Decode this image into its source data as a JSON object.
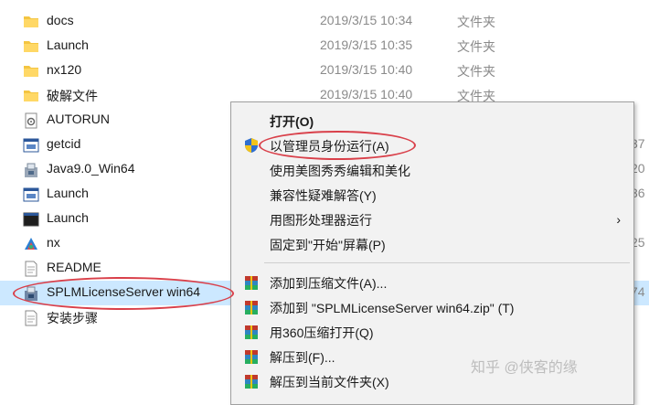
{
  "files": [
    {
      "name": "docs",
      "date": "2019/3/15 10:34",
      "type": "文件夹",
      "size": "",
      "icon": "folder-icon"
    },
    {
      "name": "Launch",
      "date": "2019/3/15 10:35",
      "type": "文件夹",
      "size": "",
      "icon": "folder-icon"
    },
    {
      "name": "nx120",
      "date": "2019/3/15 10:40",
      "type": "文件夹",
      "size": "",
      "icon": "folder-icon"
    },
    {
      "name": "破解文件",
      "date": "2019/3/15 10:40",
      "type": "文件夹",
      "size": "",
      "icon": "folder-icon"
    },
    {
      "name": "AUTORUN",
      "date": "",
      "type": "",
      "size": "",
      "icon": "settings-file-icon"
    },
    {
      "name": "getcid",
      "date": "",
      "type": "",
      "size": "37",
      "icon": "app-window-icon"
    },
    {
      "name": "Java9.0_Win64",
      "date": "",
      "type": "",
      "size": "20",
      "icon": "installer-icon"
    },
    {
      "name": "Launch",
      "date": "",
      "type": "",
      "size": "36",
      "icon": "app-window-icon"
    },
    {
      "name": "Launch",
      "date": "",
      "type": "",
      "size": "",
      "icon": "console-window-icon"
    },
    {
      "name": "nx",
      "date": "",
      "type": "",
      "size": "25",
      "icon": "nx-logo-icon"
    },
    {
      "name": "README",
      "date": "",
      "type": "",
      "size": "",
      "icon": "text-file-icon"
    },
    {
      "name": "SPLMLicenseServer win64",
      "date": "",
      "type": "",
      "size": "74",
      "icon": "installer-icon"
    },
    {
      "name": "安装步骤",
      "date": "",
      "type": "",
      "size": "",
      "icon": "text-file-icon"
    }
  ],
  "context_menu": {
    "items": [
      {
        "label": "打开(O)",
        "icon": "",
        "bold": true
      },
      {
        "label": "以管理员身份运行(A)",
        "icon": "uac-shield-icon",
        "bold": false
      },
      {
        "label": "使用美图秀秀编辑和美化",
        "icon": "",
        "bold": false
      },
      {
        "label": "兼容性疑难解答(Y)",
        "icon": "",
        "bold": false
      },
      {
        "label": "用图形处理器运行",
        "icon": "",
        "bold": false,
        "submenu": true
      },
      {
        "label": "固定到\"开始\"屏幕(P)",
        "icon": "",
        "bold": false
      },
      {
        "label": "添加到压缩文件(A)...",
        "icon": "archive-icon",
        "bold": false
      },
      {
        "label": "添加到 \"SPLMLicenseServer win64.zip\" (T)",
        "icon": "archive-icon",
        "bold": false
      },
      {
        "label": "用360压缩打开(Q)",
        "icon": "archive-icon",
        "bold": false
      },
      {
        "label": "解压到(F)...",
        "icon": "archive-icon",
        "bold": false
      },
      {
        "label": "解压到当前文件夹(X)",
        "icon": "archive-icon",
        "bold": false
      }
    ],
    "submenu_arrow": "›"
  },
  "watermark": "知乎 @侠客的缘"
}
